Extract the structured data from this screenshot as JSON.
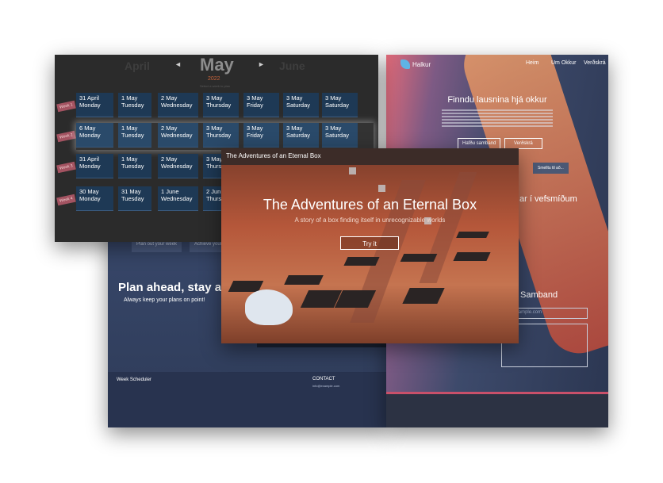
{
  "scheduler_site": {
    "plan_btn": "Plan out your week",
    "achieve_btn": "Achieve your",
    "hero": "Plan ahead, stay ahe",
    "subtitle": "Always keep your plans on point!",
    "footer_brand": "Week Scheduler",
    "footer_contact": "CONTACT",
    "footer_email": "info@example.com"
  },
  "halkur_site": {
    "brand": "Halkur",
    "nav": [
      "Heim",
      "Um Okkur",
      "Verðskrá"
    ],
    "headline": "Finndu lausnina hjá okkur",
    "btn_contact": "Hafðu samband",
    "btn_pricing": "Verðskrá",
    "btn_more": "Smelltu til að...",
    "section_partial": "ar í vefsmíðum",
    "samband": "Samband",
    "email_placeholder": "ke@example.com",
    "message_placeholder": "ð"
  },
  "calendar": {
    "prev_month": "April",
    "month": "May",
    "next_month": "June",
    "year": "2022",
    "hint": "Select a week to plan",
    "weeks": [
      {
        "label": "Week 1",
        "days": [
          "31 April\nMonday",
          "1 May\nTuesday",
          "2 May\nWednesday",
          "3 May\nThursday",
          "3 May\nFriday",
          "3 May\nSaturday",
          "3 May\nSaturday"
        ]
      },
      {
        "label": "Week 2",
        "days": [
          "6 May\nMonday",
          "1 May\nTuesday",
          "2 May\nWednesday",
          "3 May\nThursday",
          "3 May\nFriday",
          "3 May\nSaturday",
          "3 May\nSaturday"
        ]
      },
      {
        "label": "Week 3",
        "days": [
          "31 April\nMonday",
          "1 May\nTuesday",
          "2 May\nWednesday",
          "3 May\nThurs"
        ]
      },
      {
        "label": "Week 4",
        "days": [
          "30 May\nMonday",
          "31 May\nTuesday",
          "1 June\nWednesday",
          "2 Jun\nThurs"
        ]
      }
    ]
  },
  "game": {
    "window_title": "The Adventures of an Eternal Box",
    "title": "The Adventures of an Eternal Box",
    "subtitle": "A story of a box finding itself in unrecognizable worlds",
    "try_btn": "Try it"
  }
}
